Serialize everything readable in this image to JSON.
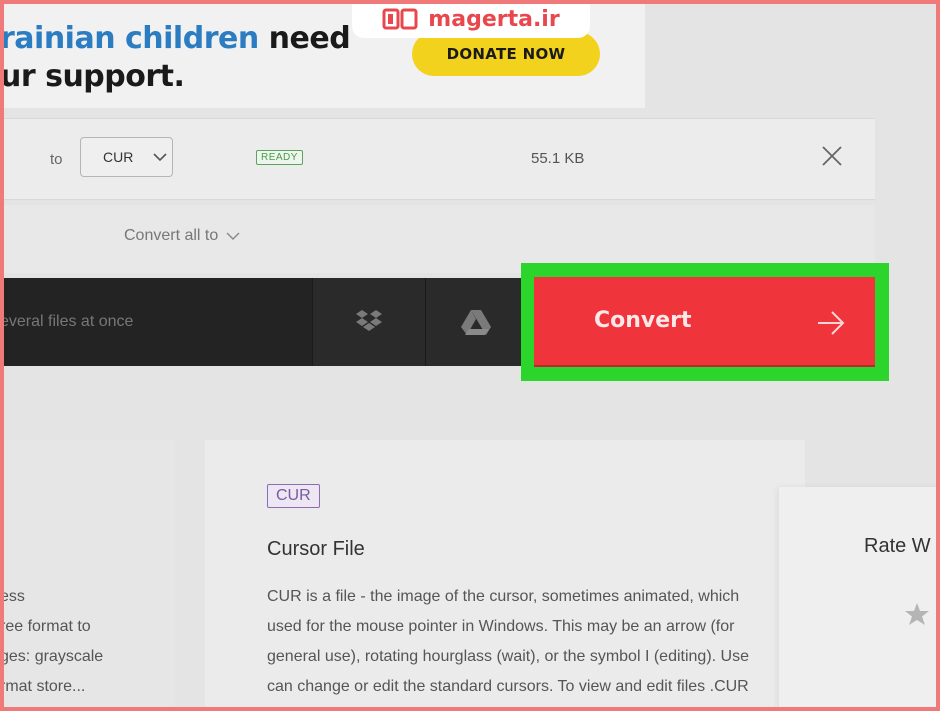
{
  "watermark": {
    "text": "magerta.ir",
    "logo_icon": "book-icon"
  },
  "banner": {
    "line1_highlight": "rainian children",
    "line1_rest": " need",
    "line2": "ur support.",
    "donate_label": "DONATE NOW"
  },
  "file_row": {
    "to_label": "to",
    "format_value": "CUR",
    "status": "READY",
    "size": "55.1 KB"
  },
  "convert_all": {
    "label": "Convert all to"
  },
  "toolbar": {
    "hint": "everal files at once",
    "dropbox_icon": "dropbox-icon",
    "gdrive_icon": "google-drive-icon",
    "convert_label": "Convert"
  },
  "left_column": {
    "lines": [
      "ess",
      "ree format to",
      "ges: grayscale",
      "rmat store..."
    ]
  },
  "info": {
    "tag": "CUR",
    "title": "Cursor File",
    "description": [
      "CUR is a file - the image of the cursor, sometimes animated, which",
      "used for the mouse pointer in Windows. This may be an arrow (for",
      "general use), rotating hourglass (wait), or the symbol I (editing). Use",
      "can change or edit the standard cursors. To view and edit files .CUR"
    ]
  },
  "rating": {
    "title": "Rate W"
  },
  "colors": {
    "convert_red": "#ef343b",
    "highlight_green": "#2bd52b",
    "donate_yellow": "#f2d21d",
    "banner_blue": "#2b7cc1",
    "frame_red": "#f07a7a"
  }
}
